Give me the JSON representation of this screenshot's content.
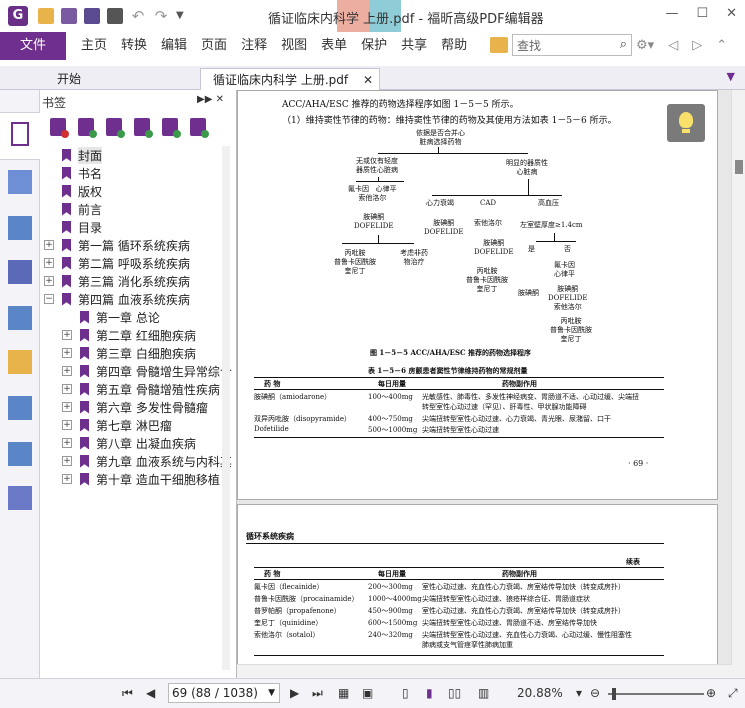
{
  "window": {
    "title": "循证临床内科学  上册.pdf - 福昕高级PDF编辑器",
    "controls": [
      "minimize",
      "maximize",
      "close"
    ]
  },
  "quick_access": [
    "open-folder-icon",
    "save-icon",
    "save-as-icon",
    "print-icon",
    "undo-icon",
    "redo-icon",
    "customize-caret-icon"
  ],
  "menu": {
    "file_label": "文件",
    "items": [
      "主页",
      "转换",
      "编辑",
      "页面",
      "注释",
      "视图",
      "表单",
      "保护",
      "共享",
      "帮助"
    ]
  },
  "search": {
    "placeholder": "查找"
  },
  "tabs": [
    {
      "label": "开始"
    },
    {
      "label": "循证临床内科学  上册.pdf"
    }
  ],
  "bookmarks": {
    "title": "书签",
    "items": [
      {
        "label": "封面",
        "level": 0,
        "expandable": false,
        "selected": true
      },
      {
        "label": "书名",
        "level": 0,
        "expandable": false
      },
      {
        "label": "版权",
        "level": 0,
        "expandable": false
      },
      {
        "label": "前言",
        "level": 0,
        "expandable": false
      },
      {
        "label": "目录",
        "level": 0,
        "expandable": false
      },
      {
        "label": "第一篇  循环系统疾病",
        "level": 0,
        "expandable": true,
        "expanded": false
      },
      {
        "label": "第二篇  呼吸系统疾病",
        "level": 0,
        "expandable": true,
        "expanded": false
      },
      {
        "label": "第三篇  消化系统疾病",
        "level": 0,
        "expandable": true,
        "expanded": false
      },
      {
        "label": "第四篇  血液系统疾病",
        "level": 0,
        "expandable": true,
        "expanded": true
      },
      {
        "label": "第一章  总论",
        "level": 1,
        "expandable": false
      },
      {
        "label": "第二章  红细胞疾病",
        "level": 1,
        "expandable": true,
        "expanded": false
      },
      {
        "label": "第三章  白细胞疾病",
        "level": 1,
        "expandable": true,
        "expanded": false
      },
      {
        "label": "第四章  骨髓增生异常综合",
        "level": 1,
        "expandable": true,
        "expanded": false
      },
      {
        "label": "第五章  骨髓增殖性疾病",
        "level": 1,
        "expandable": true,
        "expanded": false
      },
      {
        "label": "第六章  多发性骨髓瘤",
        "level": 1,
        "expandable": true,
        "expanded": false
      },
      {
        "label": "第七章  淋巴瘤",
        "level": 1,
        "expandable": true,
        "expanded": false
      },
      {
        "label": "第八章  出凝血疾病",
        "level": 1,
        "expandable": true,
        "expanded": false
      },
      {
        "label": "第九章  血液系统与内科其",
        "level": 1,
        "expandable": true,
        "expanded": false
      },
      {
        "label": "第十章  造血干细胞移植",
        "level": 1,
        "expandable": true,
        "expanded": false
      }
    ]
  },
  "page1": {
    "intro": "ACC/AHA/ESC 推荐的药物选择程序如图 1－5－5 所示。",
    "point1": "（1）维持窦性节律的药物：维持窦性节律的药物及其使用方法如表 1－5－6 所示。",
    "flow": {
      "root": "依据是否合并心\n脏病选择药物",
      "a": "无或仅有轻度\n器质性心脏病",
      "b": "明显的器质性\n心脏病",
      "a1": "氟卡因   心律平\n索他洛尔",
      "a2": "胺碘酮\nDOFELIDE",
      "a3": "丙吡胺\n普鲁卡因酰胺\n奎尼丁",
      "a4": "考虑非药\n物治疗",
      "b1": "心力衰竭",
      "b2": "CAD",
      "b3": "高血压",
      "b1a": "胺碘酮\nDOFELIDE",
      "b2a": "索他洛尔",
      "b2b": "胺碘酮\nDOFELIDE",
      "b2c": "丙吡胺\n普鲁卡因酰胺\n奎尼丁",
      "b3a": "左室壁厚度≥1.4cm",
      "yes": "是",
      "no": "否",
      "b3y": "胺碘酮",
      "b3n1": "氟卡因\n心律平",
      "b3n2": "胺碘酮\nDOFELIDE\n索他洛尔",
      "b3n3": "丙吡胺\n普鲁卡因酰胺\n奎尼丁"
    },
    "figure_caption": "图 1－5－5   ACC/AHA/ESC 推荐的药物选择程序",
    "table_caption": "表 1－5－6   房颤患者窦性节律维持药物的常规剂量",
    "table_headers": [
      "药    物",
      "每日用量",
      "药物副作用"
    ],
    "table_rows": [
      [
        "胺碘酮（amiodarone）",
        "100～400mg",
        "光敏感性、肺毒性、多发性神经病变、胃肠道不适、心动过缓、尖端扭\n转型室性心动过速（罕见）、肝毒性、甲状腺功能障碍"
      ],
      [
        "双异丙吡胺（disopyramide）",
        "400～750mg",
        "尖端扭转型室性心动过速、心力衰竭、青光眼、尿潴留、口干"
      ],
      [
        "Dofetilide",
        "500～1000mg",
        "尖端扭转型室性心动过速"
      ]
    ],
    "page_number": "· 69 ·"
  },
  "page2": {
    "running_head": "循环系统疾病",
    "continued": "续表",
    "table_headers": [
      "药    物",
      "每日用量",
      "药物副作用"
    ],
    "table_rows": [
      [
        "氟卡因（flecainide）",
        "200～300mg",
        "室性心动过速、充血性心力衰竭、房室结传导加快（转变成房扑）"
      ],
      [
        "普鲁卡因酰胺（procainamide）",
        "1000～4000mg",
        "尖端扭转型室性心动过速、狼疮样综合征、胃肠道症状"
      ],
      [
        "普罗帕酮（propafenone）",
        "450～900mg",
        "室性心动过速、充血性心力衰竭、房室结传导加快（转变成房扑）"
      ],
      [
        "奎尼丁（quinidine）",
        "600～1500mg",
        "尖端扭转型室性心动过速、胃肠道不适、房室结传导加快"
      ],
      [
        "索他洛尔（sotalol）",
        "240～320mg",
        "尖端扭转型室性心动过速、充血性心力衰竭、心动过缓、慢性阻塞性\n肺病或支气管痉挛性肺病加重"
      ]
    ]
  },
  "status": {
    "page_field": "69 (88 / 1038)",
    "zoom": "20.88%"
  },
  "colors": {
    "brand": "#6e2f8e",
    "flag": "#6e2f8e"
  }
}
